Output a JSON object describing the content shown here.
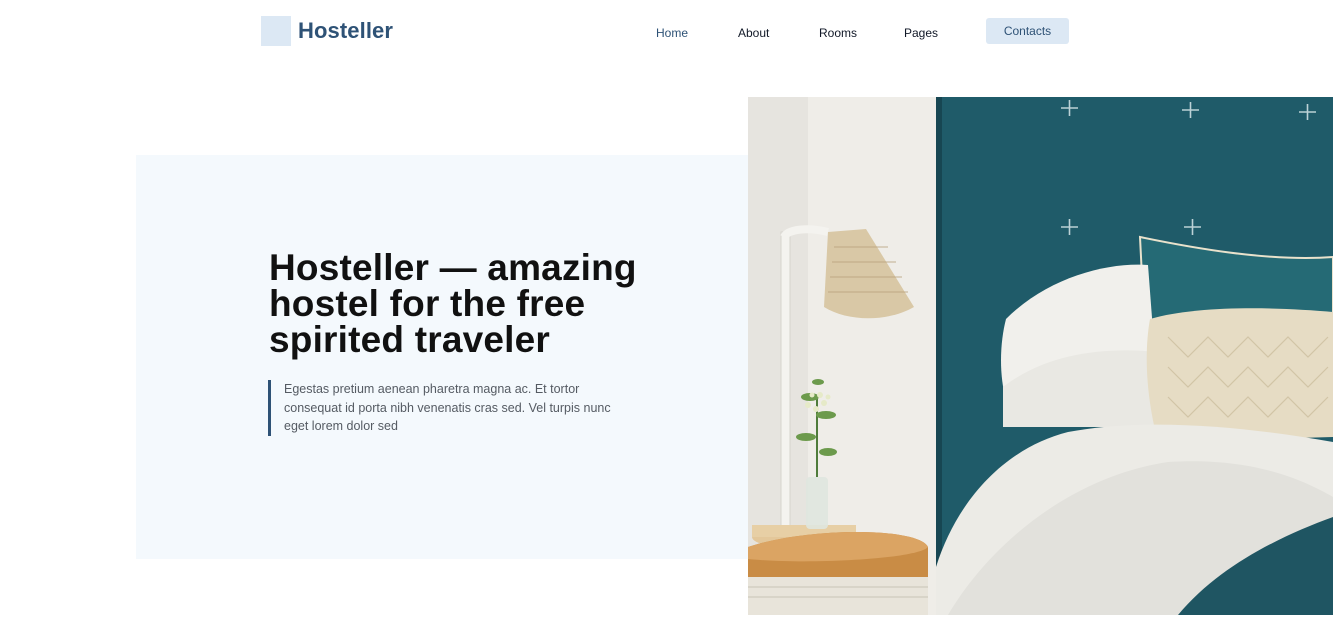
{
  "brand": {
    "name": "Hosteller"
  },
  "nav": {
    "items": [
      {
        "label": "Home"
      },
      {
        "label": "About"
      },
      {
        "label": "Rooms"
      },
      {
        "label": "Pages"
      }
    ],
    "cta_label": "Contacts"
  },
  "hero": {
    "title": "Hosteller — amazing hostel for the free spirited traveler",
    "text": "Egestas pretium aenean pharetra magna ac. Et tortor consequat id porta nibh venenatis cras sed. Vel turpis nunc eget lorem dolor sed"
  },
  "colors": {
    "brand": "#2e5276",
    "accent_light": "#dce8f4",
    "hero_background": "#f4f9fd",
    "headboard_teal": "#1f5b69"
  },
  "image": {
    "subject_icon": "bedroom-photo"
  }
}
